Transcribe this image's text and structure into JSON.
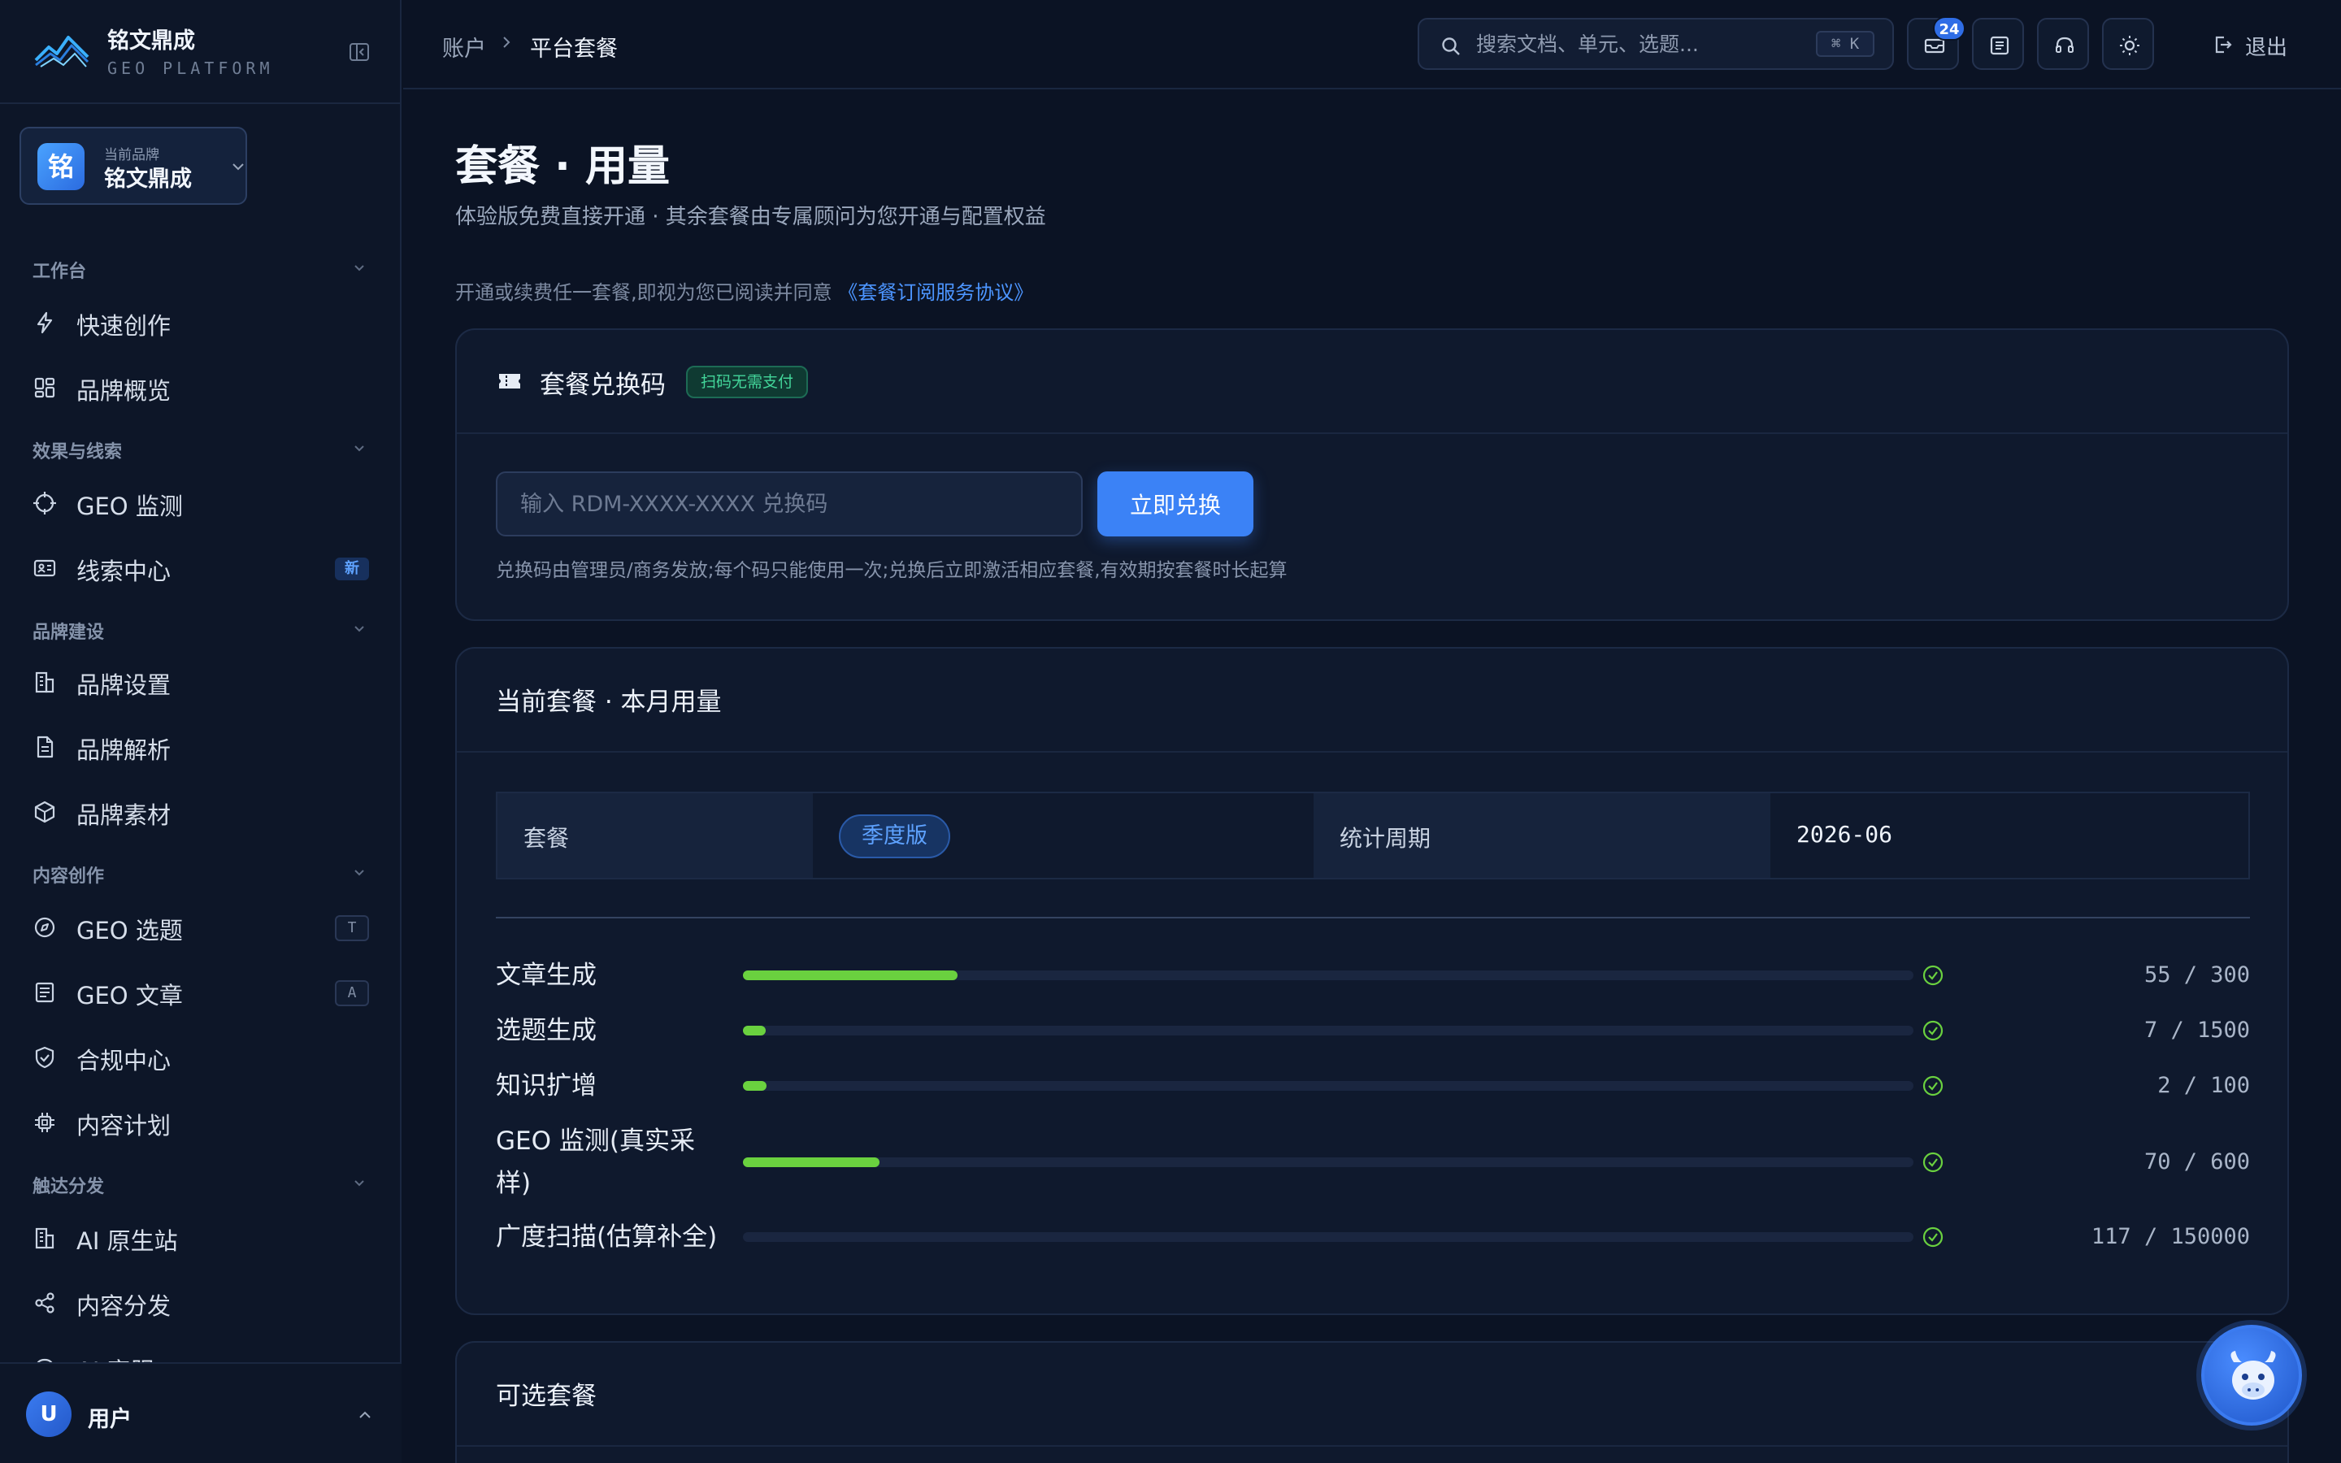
{
  "app": {
    "name": "铭文鼎成",
    "subtitle": "GEO PLATFORM"
  },
  "brand": {
    "avatar": "铭",
    "caption": "当前品牌",
    "name": "铭文鼎成"
  },
  "sidebar": {
    "sections": [
      {
        "title": "工作台",
        "items": [
          {
            "label": "快速创作",
            "icon": "lightning-icon"
          },
          {
            "label": "品牌概览",
            "icon": "dashboard-icon"
          }
        ]
      },
      {
        "title": "效果与线索",
        "items": [
          {
            "label": "GEO 监测",
            "icon": "crosshair-icon"
          },
          {
            "label": "线索中心",
            "icon": "id-card-icon",
            "badge": "新"
          }
        ]
      },
      {
        "title": "品牌建设",
        "items": [
          {
            "label": "品牌设置",
            "icon": "building-icon"
          },
          {
            "label": "品牌解析",
            "icon": "document-icon"
          },
          {
            "label": "品牌素材",
            "icon": "cube-icon"
          }
        ]
      },
      {
        "title": "内容创作",
        "items": [
          {
            "label": "GEO 选题",
            "icon": "compass-icon",
            "kbd": "T"
          },
          {
            "label": "GEO 文章",
            "icon": "article-icon",
            "kbd": "A"
          },
          {
            "label": "合规中心",
            "icon": "shield-check-icon"
          },
          {
            "label": "内容计划",
            "icon": "chip-icon"
          }
        ]
      },
      {
        "title": "触达分发",
        "items": [
          {
            "label": "AI 原生站",
            "icon": "building-icon"
          },
          {
            "label": "内容分发",
            "icon": "share-icon"
          },
          {
            "label": "AI 客服",
            "icon": "headset-icon"
          }
        ]
      }
    ]
  },
  "user": {
    "avatar": "U",
    "name": "用户"
  },
  "header": {
    "breadcrumb": [
      "账户",
      "平台套餐"
    ],
    "search_placeholder": "搜索文档、单元、选题...",
    "search_shortcut": "⌘ K",
    "mail_count": "24",
    "logout_label": "退出"
  },
  "page": {
    "title": "套餐 · 用量",
    "subtitle": "体验版免费直接开通 · 其余套餐由专属顾问为您开通与配置权益",
    "agreement_prefix": "开通或续费任一套餐,即视为您已阅读并同意 ",
    "agreement_link": "《套餐订阅服务协议》"
  },
  "redeem": {
    "title": "套餐兑换码",
    "tag": "扫码无需支付",
    "input_placeholder": "输入 RDM-XXXX-XXXX 兑换码",
    "button": "立即兑换",
    "hint": "兑换码由管理员/商务发放;每个码只能使用一次;兑换后立即激活相应套餐,有效期按套餐时长起算"
  },
  "usage": {
    "title": "当前套餐 · 本月用量",
    "plan_label": "套餐",
    "plan_value": "季度版",
    "period_label": "统计周期",
    "period_value": "2026-06",
    "rows": [
      {
        "label": "文章生成",
        "used": 55,
        "total": 300,
        "value": "55 / 300"
      },
      {
        "label": "选题生成",
        "used": 7,
        "total": 1500,
        "value": "7 / 1500"
      },
      {
        "label": "知识扩增",
        "used": 2,
        "total": 100,
        "value": "2 / 100"
      },
      {
        "label": "GEO 监测(真实采样)",
        "used": 70,
        "total": 600,
        "value": "70 / 600"
      },
      {
        "label": "广度扫描(估算补全)",
        "used": 117,
        "total": 150000,
        "value": "117 / 150000"
      }
    ]
  },
  "plans": {
    "title": "可选套餐"
  },
  "colors": {
    "accent": "#3b82f6",
    "progress": "#6ad13f",
    "success": "#43d69a"
  }
}
